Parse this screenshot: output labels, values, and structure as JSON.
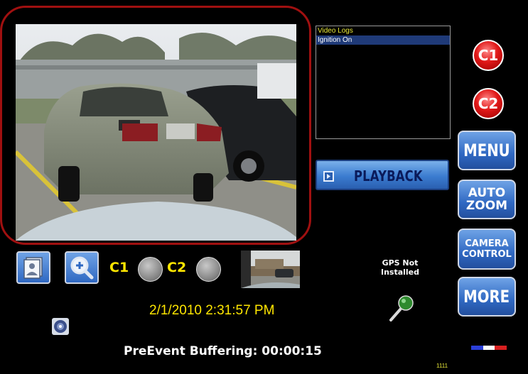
{
  "log_list": {
    "header": "Video Logs",
    "items": [
      "Ignition On"
    ]
  },
  "playback": {
    "label": "PLAYBACK"
  },
  "right_panel": {
    "c1_label": "C1",
    "c2_label": "C2",
    "menu_label": "MENU",
    "auto_zoom_line1": "AUTO",
    "auto_zoom_line2": "ZOOM",
    "camera_control_line1": "CAMERA",
    "camera_control_line2": "CONTROL",
    "more_label": "MORE"
  },
  "camera_status": {
    "c1_label": "C1",
    "c2_label": "C2"
  },
  "gps": {
    "line1": "GPS Not",
    "line2": "Installed"
  },
  "datetime": "2/1/2010 2:31:57 PM",
  "status": "PreEvent Buffering: 00:00:15",
  "counter": "1111",
  "colors": {
    "frame_red": "#a01010",
    "button_blue": "#2f68c2",
    "camera_red": "#e01818",
    "label_yellow": "#ffe600"
  },
  "icons": [
    "playback-icon",
    "snapshot-icon",
    "zoom-magnifier-icon",
    "microphone-icon",
    "gps-target-icon",
    "record-indicator-icon"
  ]
}
